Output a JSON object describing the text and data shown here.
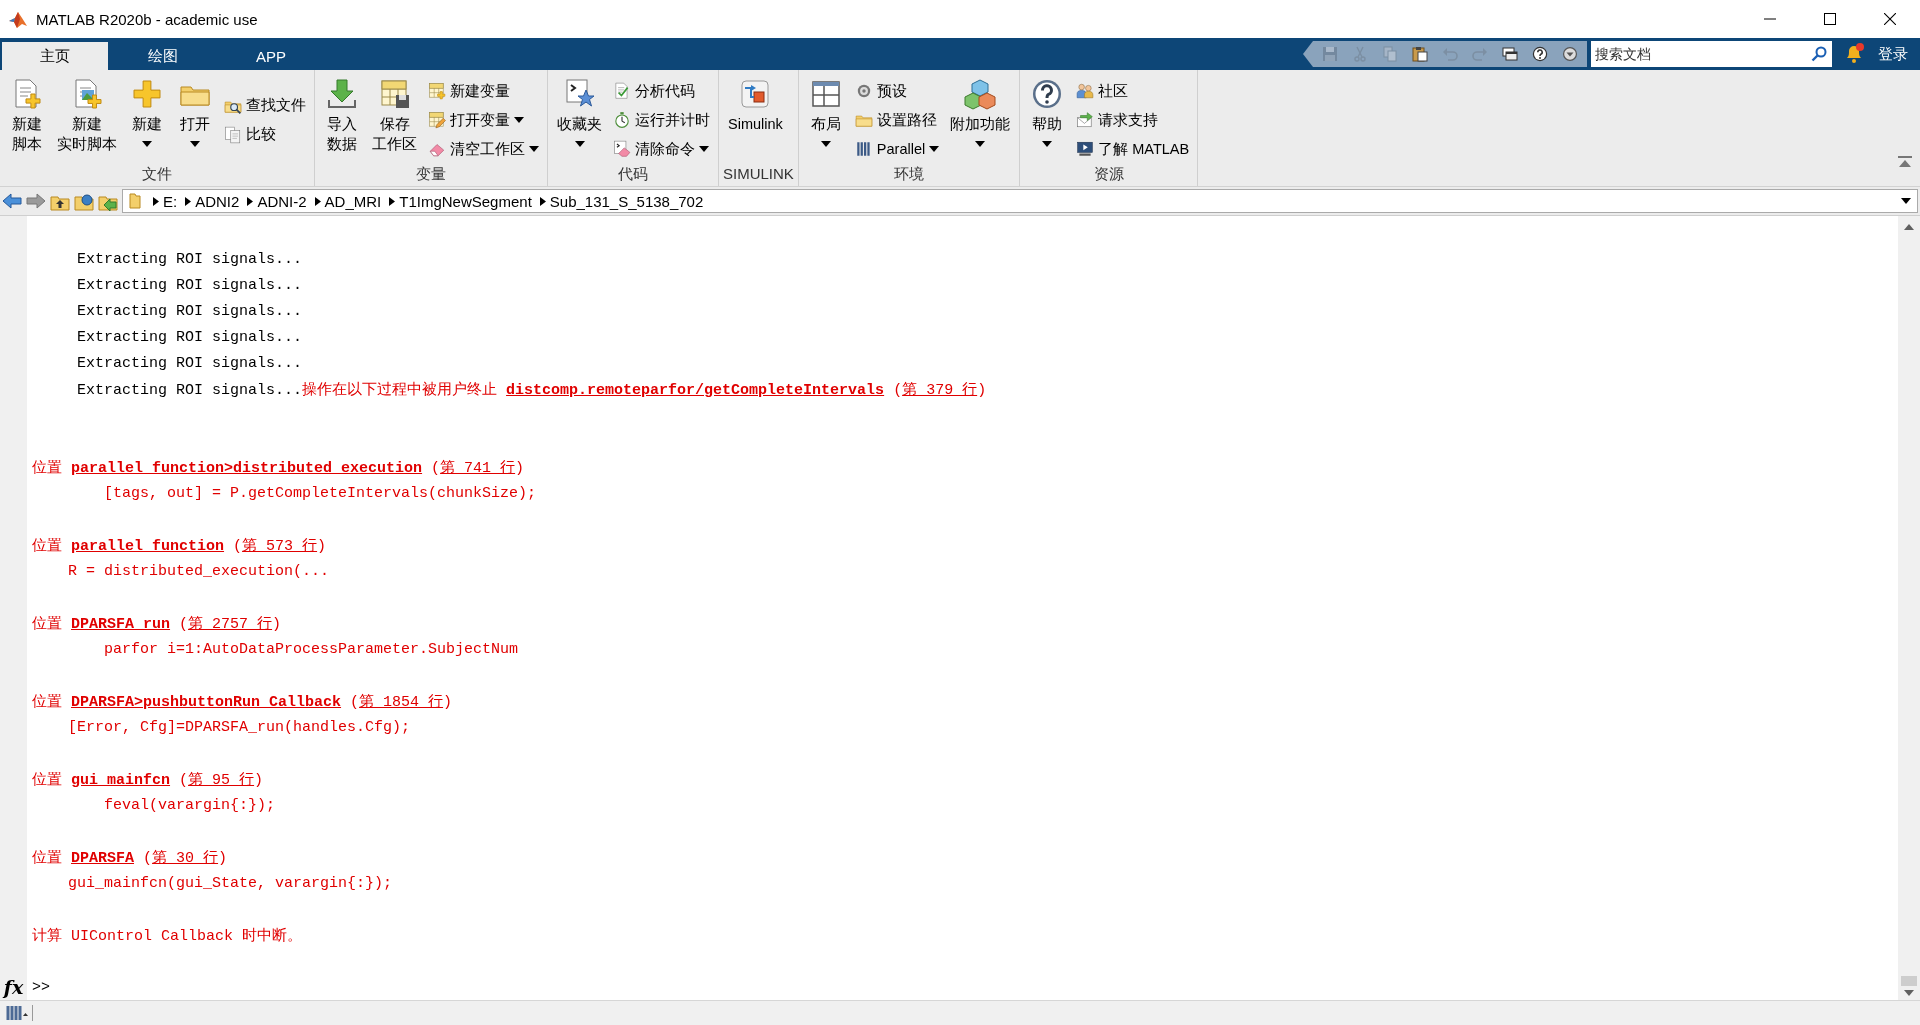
{
  "window": {
    "title": "MATLAB R2020b - academic use"
  },
  "tabs": [
    {
      "label": "主页",
      "selected": true
    },
    {
      "label": "绘图",
      "selected": false
    },
    {
      "label": "APP",
      "selected": false
    }
  ],
  "quick_access": [
    {
      "disabled": true
    },
    {
      "disabled": true
    },
    {
      "disabled": true
    },
    {
      "disabled": false
    },
    {
      "disabled": true
    },
    {
      "disabled": true
    },
    {
      "disabled": false
    },
    {
      "disabled": false
    },
    {
      "disabled": false
    }
  ],
  "search": {
    "placeholder": "搜索文档"
  },
  "notifications": {
    "unread": true
  },
  "sign_in": "登录",
  "ribbon": {
    "groups": [
      {
        "title": "文件",
        "items": [
          {
            "kind": "large",
            "label_lines": [
              "新建",
              "脚本"
            ],
            "dropdown": false
          },
          {
            "kind": "large",
            "label_lines": [
              "新建",
              "实时脚本"
            ],
            "dropdown": false
          },
          {
            "kind": "large",
            "label": "新建",
            "dropdown": true
          },
          {
            "kind": "large",
            "label": "打开",
            "dropdown": true
          },
          {
            "kind": "small",
            "label": "查找文件",
            "dropdown": false
          },
          {
            "kind": "small",
            "label": "比较",
            "dropdown": false
          }
        ]
      },
      {
        "title": "变量",
        "items": [
          {
            "kind": "large",
            "label_lines": [
              "导入",
              "数据"
            ],
            "dropdown": false
          },
          {
            "kind": "large",
            "label_lines": [
              "保存",
              "工作区"
            ],
            "dropdown": false
          },
          {
            "kind": "small",
            "label": "新建变量",
            "dropdown": false
          },
          {
            "kind": "small",
            "label": "打开变量",
            "dropdown": true
          },
          {
            "kind": "small",
            "label": "清空工作区",
            "dropdown": true
          }
        ]
      },
      {
        "title": "代码",
        "items": [
          {
            "kind": "large",
            "label": "收藏夹",
            "dropdown": true
          },
          {
            "kind": "small",
            "label": "分析代码",
            "dropdown": false
          },
          {
            "kind": "small",
            "label": "运行并计时",
            "dropdown": false
          },
          {
            "kind": "small",
            "label": "清除命令",
            "dropdown": true
          }
        ]
      },
      {
        "title": "SIMULINK",
        "items": [
          {
            "kind": "large",
            "label": "Simulink",
            "dropdown": false
          }
        ]
      },
      {
        "title": "环境",
        "items": [
          {
            "kind": "large",
            "label": "布局",
            "dropdown": true
          },
          {
            "kind": "small",
            "label": "预设",
            "dropdown": false
          },
          {
            "kind": "small",
            "label": "设置路径",
            "dropdown": false
          },
          {
            "kind": "small",
            "label": "Parallel",
            "dropdown": true
          },
          {
            "kind": "large",
            "label": "附加功能",
            "dropdown": true
          }
        ]
      },
      {
        "title": "资源",
        "items": [
          {
            "kind": "large",
            "label": "帮助",
            "dropdown": true
          },
          {
            "kind": "small",
            "label": "社区",
            "dropdown": false
          },
          {
            "kind": "small",
            "label": "请求支持",
            "dropdown": false
          },
          {
            "kind": "small",
            "label": "了解 MATLAB",
            "dropdown": false
          }
        ]
      }
    ]
  },
  "address_bar": {
    "path": [
      "E:",
      "ADNI2",
      "ADNI-2",
      "AD_MRI",
      "T1ImgNewSegment",
      "Sub_131_S_5138_702"
    ]
  },
  "command_window": {
    "lines": [
      {
        "kind": "blank"
      },
      {
        "kind": "text",
        "parts": [
          {
            "kind": "plain",
            "text": "     Extracting ROI signals..."
          }
        ]
      },
      {
        "kind": "text",
        "parts": [
          {
            "kind": "plain",
            "text": "     Extracting ROI signals..."
          }
        ]
      },
      {
        "kind": "text",
        "parts": [
          {
            "kind": "plain",
            "text": "     Extracting ROI signals..."
          }
        ]
      },
      {
        "kind": "text",
        "parts": [
          {
            "kind": "plain",
            "text": "     Extracting ROI signals..."
          }
        ]
      },
      {
        "kind": "text",
        "parts": [
          {
            "kind": "plain",
            "text": "     Extracting ROI signals..."
          }
        ]
      },
      {
        "kind": "text",
        "parts": [
          {
            "kind": "plain",
            "text": "     Extracting ROI signals..."
          },
          {
            "kind": "error",
            "text": "操作在以下过程中被用户终止 "
          },
          {
            "kind": "function_link",
            "text": "distcomp.remoteparfor/getCompleteIntervals"
          },
          {
            "kind": "error",
            "text": " ("
          },
          {
            "kind": "line_link",
            "text": "第 379 行"
          },
          {
            "kind": "error",
            "text": ")"
          }
        ]
      },
      {
        "kind": "blank"
      },
      {
        "kind": "blank"
      },
      {
        "kind": "text",
        "parts": [
          {
            "kind": "error",
            "text": "位置 "
          },
          {
            "kind": "function_link",
            "text": "parallel_function>distributed_execution"
          },
          {
            "kind": "error",
            "text": " ("
          },
          {
            "kind": "line_link",
            "text": "第 741 行"
          },
          {
            "kind": "error",
            "text": ")"
          }
        ]
      },
      {
        "kind": "text",
        "parts": [
          {
            "kind": "error",
            "text": "        [tags, out] = P.getCompleteIntervals(chunkSize);"
          }
        ]
      },
      {
        "kind": "blank"
      },
      {
        "kind": "text",
        "parts": [
          {
            "kind": "error",
            "text": "位置 "
          },
          {
            "kind": "function_link",
            "text": "parallel_function"
          },
          {
            "kind": "error",
            "text": " ("
          },
          {
            "kind": "line_link",
            "text": "第 573 行"
          },
          {
            "kind": "error",
            "text": ")"
          }
        ]
      },
      {
        "kind": "text",
        "parts": [
          {
            "kind": "error",
            "text": "    R = distributed_execution(..."
          }
        ]
      },
      {
        "kind": "blank"
      },
      {
        "kind": "text",
        "parts": [
          {
            "kind": "error",
            "text": "位置 "
          },
          {
            "kind": "function_link",
            "text": "DPARSFA_run"
          },
          {
            "kind": "error",
            "text": " ("
          },
          {
            "kind": "line_link",
            "text": "第 2757 行"
          },
          {
            "kind": "error",
            "text": ")"
          }
        ]
      },
      {
        "kind": "text",
        "parts": [
          {
            "kind": "error",
            "text": "        parfor i=1:AutoDataProcessParameter.SubjectNum"
          }
        ]
      },
      {
        "kind": "blank"
      },
      {
        "kind": "text",
        "parts": [
          {
            "kind": "error",
            "text": "位置 "
          },
          {
            "kind": "function_link",
            "text": "DPARSFA>pushbuttonRun_Callback"
          },
          {
            "kind": "error",
            "text": " ("
          },
          {
            "kind": "line_link",
            "text": "第 1854 行"
          },
          {
            "kind": "error",
            "text": ")"
          }
        ]
      },
      {
        "kind": "text",
        "parts": [
          {
            "kind": "error",
            "text": "    [Error, Cfg]=DPARSFA_run(handles.Cfg);"
          }
        ]
      },
      {
        "kind": "blank"
      },
      {
        "kind": "text",
        "parts": [
          {
            "kind": "error",
            "text": "位置 "
          },
          {
            "kind": "function_link",
            "text": "gui_mainfcn"
          },
          {
            "kind": "error",
            "text": " ("
          },
          {
            "kind": "line_link",
            "text": "第 95 行"
          },
          {
            "kind": "error",
            "text": ")"
          }
        ]
      },
      {
        "kind": "text",
        "parts": [
          {
            "kind": "error",
            "text": "        feval(varargin{:});"
          }
        ]
      },
      {
        "kind": "blank"
      },
      {
        "kind": "text",
        "parts": [
          {
            "kind": "error",
            "text": "位置 "
          },
          {
            "kind": "function_link",
            "text": "DPARSFA"
          },
          {
            "kind": "error",
            "text": " ("
          },
          {
            "kind": "line_link",
            "text": "第 30 行"
          },
          {
            "kind": "error",
            "text": ")"
          }
        ]
      },
      {
        "kind": "text",
        "parts": [
          {
            "kind": "error",
            "text": "    gui_mainfcn(gui_State, varargin{:});"
          }
        ]
      },
      {
        "kind": "blank"
      },
      {
        "kind": "text",
        "parts": [
          {
            "kind": "error",
            "text": "计算 UIControl Callback 时中断。"
          }
        ]
      },
      {
        "kind": "blank"
      }
    ],
    "prompt": {
      "function_button": "fx",
      "symbol": ">>"
    }
  }
}
